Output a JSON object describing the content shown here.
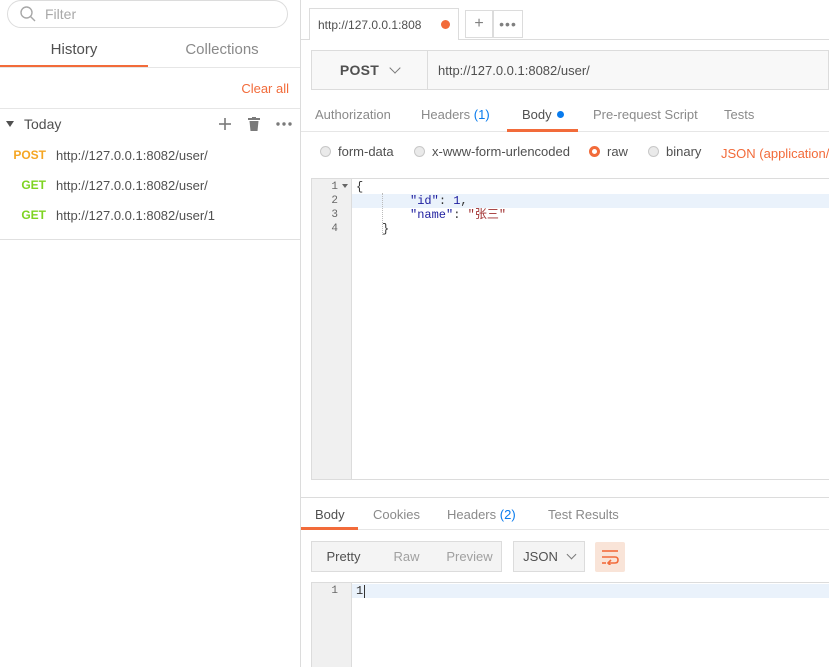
{
  "sidebar": {
    "filter_placeholder": "Filter",
    "tabs": [
      {
        "label": "History"
      },
      {
        "label": "Collections"
      }
    ],
    "clear_all": "Clear all",
    "group_title": "Today",
    "history": [
      {
        "method": "POST",
        "url": "http://127.0.0.1:8082/user/",
        "color": "#f5a623"
      },
      {
        "method": "GET",
        "url": "http://127.0.0.1:8082/user/",
        "color": "#7ed321"
      },
      {
        "method": "GET",
        "url": "http://127.0.0.1:8082/user/1",
        "color": "#7ed321"
      }
    ]
  },
  "request_tab": {
    "title": "http://127.0.0.1:808",
    "plus": "+",
    "more": "•••"
  },
  "request": {
    "method": "POST",
    "url": "http://127.0.0.1:8082/user/",
    "tabs": {
      "authorization": "Authorization",
      "headers": "Headers",
      "headers_count": "(1)",
      "body": "Body",
      "prerequest": "Pre-request Script",
      "tests": "Tests"
    },
    "body_options": {
      "form_data": "form-data",
      "urlencoded": "x-www-form-urlencoded",
      "raw": "raw",
      "binary": "binary",
      "content_type": "JSON (application/js"
    },
    "editor": {
      "line_numbers": [
        "1",
        "2",
        "3",
        "4"
      ],
      "brace_open": "{",
      "id_key": "\"id\"",
      "id_value": "1",
      "name_key": "\"name\"",
      "name_value": "\"张三\"",
      "brace_close": "}"
    }
  },
  "response": {
    "tabs": {
      "body": "Body",
      "cookies": "Cookies",
      "headers": "Headers",
      "headers_count": "(2)",
      "test_results": "Test Results"
    },
    "view_modes": [
      "Pretty",
      "Raw",
      "Preview"
    ],
    "format": "JSON",
    "line_numbers": [
      "1"
    ],
    "content": "1"
  },
  "colors": {
    "accent": "#f26b3a",
    "link_blue": "#097bed",
    "post": "#f5a623",
    "get": "#7ed321"
  }
}
